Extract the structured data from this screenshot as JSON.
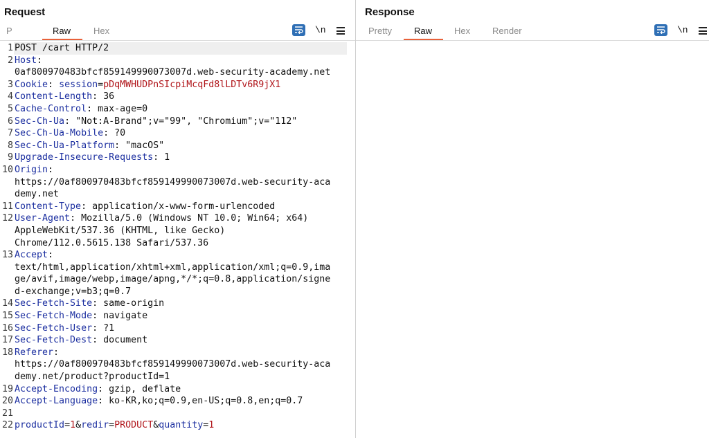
{
  "request": {
    "title": "Request",
    "tabs": [
      {
        "label": "P",
        "active": false
      },
      {
        "label": "Raw",
        "active": true
      },
      {
        "label": "Hex",
        "active": false
      }
    ],
    "newline_label": "\\n",
    "lines": [
      {
        "num": "1",
        "segments": [
          {
            "t": "POST /cart HTTP/2",
            "c": "plain"
          }
        ]
      },
      {
        "num": "2",
        "segments": [
          {
            "t": "Host",
            "c": "key"
          },
          {
            "t": ":",
            "c": "plain"
          }
        ]
      },
      {
        "num": "",
        "segments": [
          {
            "t": "0af800970483bfcf859149990073007d.web-security-academy.net",
            "c": "plain"
          }
        ]
      },
      {
        "num": "3",
        "segments": [
          {
            "t": "Cookie",
            "c": "key"
          },
          {
            "t": ": ",
            "c": "plain"
          },
          {
            "t": "session",
            "c": "key"
          },
          {
            "t": "=",
            "c": "plain"
          },
          {
            "t": "pDqMWHUDPnSIcpiMcqFd8lLDTv6R9jX1",
            "c": "val"
          }
        ]
      },
      {
        "num": "4",
        "segments": [
          {
            "t": "Content-Length",
            "c": "key"
          },
          {
            "t": ": 36",
            "c": "plain"
          }
        ]
      },
      {
        "num": "5",
        "segments": [
          {
            "t": "Cache-Control",
            "c": "key"
          },
          {
            "t": ": max-age=0",
            "c": "plain"
          }
        ]
      },
      {
        "num": "6",
        "segments": [
          {
            "t": "Sec-Ch-Ua",
            "c": "key"
          },
          {
            "t": ": \"Not:A-Brand\";v=\"99\", \"Chromium\";v=\"112\"",
            "c": "plain"
          }
        ]
      },
      {
        "num": "7",
        "segments": [
          {
            "t": "Sec-Ch-Ua-Mobile",
            "c": "key"
          },
          {
            "t": ": ?0",
            "c": "plain"
          }
        ]
      },
      {
        "num": "8",
        "segments": [
          {
            "t": "Sec-Ch-Ua-Platform",
            "c": "key"
          },
          {
            "t": ": \"macOS\"",
            "c": "plain"
          }
        ]
      },
      {
        "num": "9",
        "segments": [
          {
            "t": "Upgrade-Insecure-Requests",
            "c": "key"
          },
          {
            "t": ": 1",
            "c": "plain"
          }
        ]
      },
      {
        "num": "10",
        "segments": [
          {
            "t": "Origin",
            "c": "key"
          },
          {
            "t": ":",
            "c": "plain"
          }
        ]
      },
      {
        "num": "",
        "segments": [
          {
            "t": "https://0af800970483bfcf859149990073007d.web-security-aca",
            "c": "plain"
          }
        ]
      },
      {
        "num": "",
        "segments": [
          {
            "t": "demy.net",
            "c": "plain"
          }
        ]
      },
      {
        "num": "11",
        "segments": [
          {
            "t": "Content-Type",
            "c": "key"
          },
          {
            "t": ": application/x-www-form-urlencoded",
            "c": "plain"
          }
        ]
      },
      {
        "num": "12",
        "segments": [
          {
            "t": "User-Agent",
            "c": "key"
          },
          {
            "t": ": Mozilla/5.0 (Windows NT 10.0; Win64; x64)",
            "c": "plain"
          }
        ]
      },
      {
        "num": "",
        "segments": [
          {
            "t": "AppleWebKit/537.36 (KHTML, like Gecko)",
            "c": "plain"
          }
        ]
      },
      {
        "num": "",
        "segments": [
          {
            "t": "Chrome/112.0.5615.138 Safari/537.36",
            "c": "plain"
          }
        ]
      },
      {
        "num": "13",
        "segments": [
          {
            "t": "Accept",
            "c": "key"
          },
          {
            "t": ":",
            "c": "plain"
          }
        ]
      },
      {
        "num": "",
        "segments": [
          {
            "t": "text/html,application/xhtml+xml,application/xml;q=0.9,ima",
            "c": "plain"
          }
        ]
      },
      {
        "num": "",
        "segments": [
          {
            "t": "ge/avif,image/webp,image/apng,*/*;q=0.8,application/signe",
            "c": "plain"
          }
        ]
      },
      {
        "num": "",
        "segments": [
          {
            "t": "d-exchange;v=b3;q=0.7",
            "c": "plain"
          }
        ]
      },
      {
        "num": "14",
        "segments": [
          {
            "t": "Sec-Fetch-Site",
            "c": "key"
          },
          {
            "t": ": same-origin",
            "c": "plain"
          }
        ]
      },
      {
        "num": "15",
        "segments": [
          {
            "t": "Sec-Fetch-Mode",
            "c": "key"
          },
          {
            "t": ": navigate",
            "c": "plain"
          }
        ]
      },
      {
        "num": "16",
        "segments": [
          {
            "t": "Sec-Fetch-User",
            "c": "key"
          },
          {
            "t": ": ?1",
            "c": "plain"
          }
        ]
      },
      {
        "num": "17",
        "segments": [
          {
            "t": "Sec-Fetch-Dest",
            "c": "key"
          },
          {
            "t": ": document",
            "c": "plain"
          }
        ]
      },
      {
        "num": "18",
        "segments": [
          {
            "t": "Referer",
            "c": "key"
          },
          {
            "t": ":",
            "c": "plain"
          }
        ]
      },
      {
        "num": "",
        "segments": [
          {
            "t": "https://0af800970483bfcf859149990073007d.web-security-aca",
            "c": "plain"
          }
        ]
      },
      {
        "num": "",
        "segments": [
          {
            "t": "demy.net/product?productId=1",
            "c": "plain"
          }
        ]
      },
      {
        "num": "19",
        "segments": [
          {
            "t": "Accept-Encoding",
            "c": "key"
          },
          {
            "t": ": gzip, deflate",
            "c": "plain"
          }
        ]
      },
      {
        "num": "20",
        "segments": [
          {
            "t": "Accept-Language",
            "c": "key"
          },
          {
            "t": ": ko-KR,ko;q=0.9,en-US;q=0.8,en;q=0.7",
            "c": "plain"
          }
        ]
      },
      {
        "num": "21",
        "segments": [
          {
            "t": "",
            "c": "plain"
          }
        ]
      },
      {
        "num": "22",
        "segments": [
          {
            "t": "productId",
            "c": "key"
          },
          {
            "t": "=",
            "c": "plain"
          },
          {
            "t": "1",
            "c": "val"
          },
          {
            "t": "&",
            "c": "plain"
          },
          {
            "t": "redir",
            "c": "key"
          },
          {
            "t": "=",
            "c": "plain"
          },
          {
            "t": "PRODUCT",
            "c": "val"
          },
          {
            "t": "&",
            "c": "plain"
          },
          {
            "t": "quantity",
            "c": "key"
          },
          {
            "t": "=",
            "c": "plain"
          },
          {
            "t": "1",
            "c": "val"
          }
        ]
      }
    ]
  },
  "response": {
    "title": "Response",
    "tabs": [
      {
        "label": "Pretty",
        "active": false
      },
      {
        "label": "Raw",
        "active": true
      },
      {
        "label": "Hex",
        "active": false
      },
      {
        "label": "Render",
        "active": false
      }
    ],
    "newline_label": "\\n"
  },
  "layout_switch": {
    "options": [
      "side-by-side",
      "stacked-rows",
      "single"
    ],
    "selected": "side-by-side"
  },
  "colors": {
    "accent": "#e8613a",
    "button_blue": "#2f6fb5",
    "header_key": "#1c2fa0",
    "value_red": "#b0151a"
  }
}
